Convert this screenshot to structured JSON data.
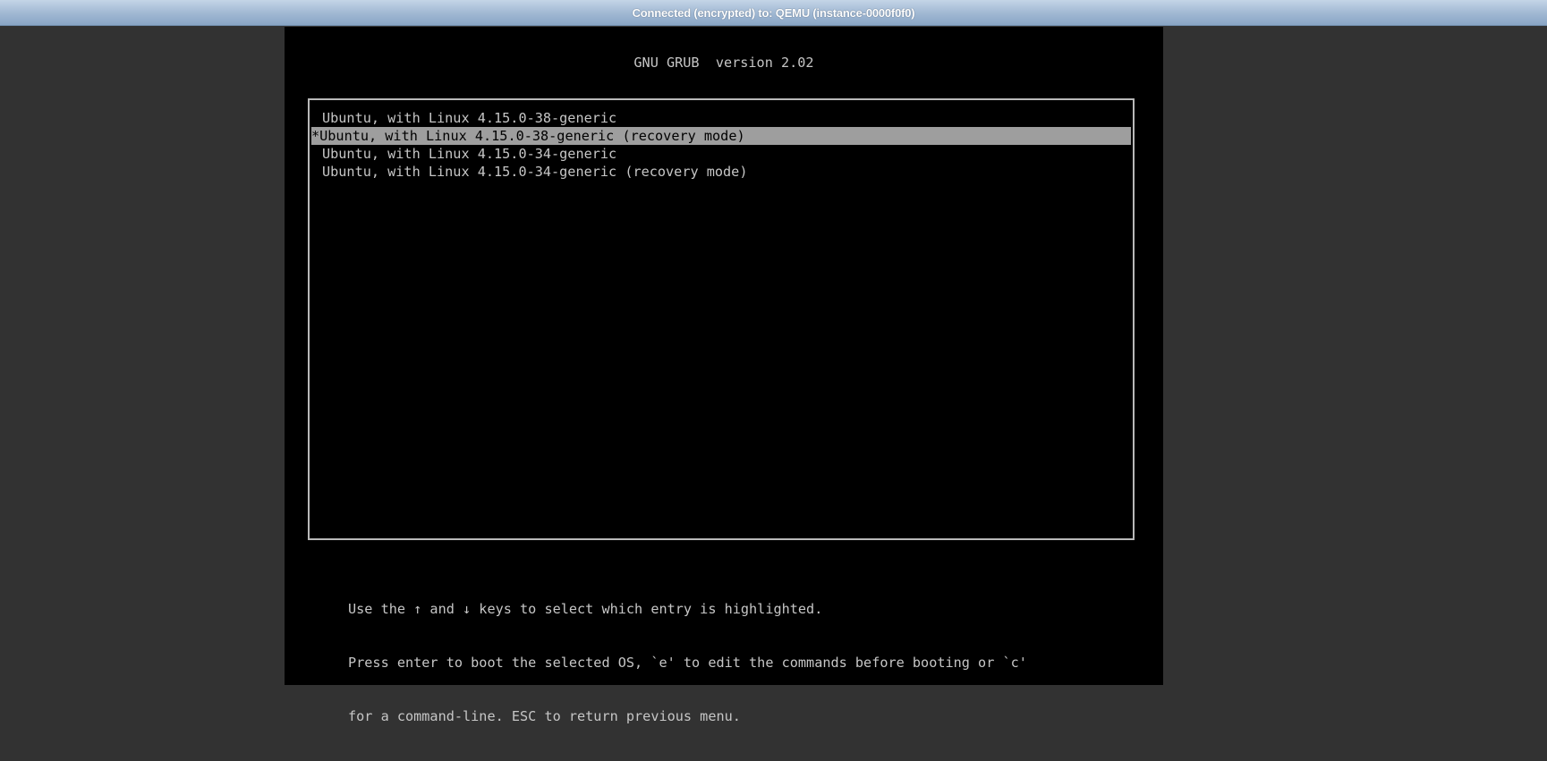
{
  "status_bar": {
    "text": "Connected (encrypted) to: QEMU (instance-0000f0f0)"
  },
  "grub": {
    "header": "GNU GRUB  version 2.02",
    "entries": [
      {
        "label": "Ubuntu, with Linux 4.15.0-38-generic",
        "selected": false
      },
      {
        "label": "*Ubuntu, with Linux 4.15.0-38-generic (recovery mode)",
        "selected": true
      },
      {
        "label": "Ubuntu, with Linux 4.15.0-34-generic",
        "selected": false
      },
      {
        "label": "Ubuntu, with Linux 4.15.0-34-generic (recovery mode)",
        "selected": false
      }
    ],
    "help": [
      "Use the ↑ and ↓ keys to select which entry is highlighted.",
      "Press enter to boot the selected OS, `e' to edit the commands before booting or `c'",
      "for a command-line. ESC to return previous menu."
    ]
  },
  "colors": {
    "terminal_bg": "#000000",
    "terminal_fg": "#c6c6c6",
    "highlight_bg": "#9e9e9e",
    "page_bg": "#323232"
  }
}
